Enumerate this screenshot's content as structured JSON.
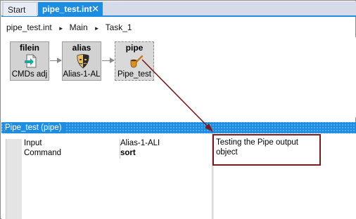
{
  "tabs": [
    {
      "label": "Start",
      "active": false
    },
    {
      "label": "pipe_test.int",
      "active": true
    }
  ],
  "close_glyph": "✕",
  "breadcrumb": [
    "pipe_test.int",
    "Main",
    "Task_1"
  ],
  "breadcrumb_sep": "►",
  "nodes": [
    {
      "title": "filein",
      "label": "CMDs adj",
      "icon": "file-input-icon"
    },
    {
      "title": "alias",
      "label": "Alias-1-AL",
      "icon": "theater-masks-icon"
    },
    {
      "title": "pipe",
      "label": "Pipe_test",
      "icon": "smoking-pipe-icon"
    }
  ],
  "panel": {
    "title": "Pipe_test (pipe)",
    "properties": [
      {
        "key": "Input",
        "value": "Alias-1-ALI",
        "bold": false
      },
      {
        "key": "Command",
        "value": "sort",
        "bold": true
      }
    ],
    "description": "Testing the Pipe output object"
  },
  "colors": {
    "accent": "#1c8de0",
    "annotation": "#7a1a1a"
  }
}
